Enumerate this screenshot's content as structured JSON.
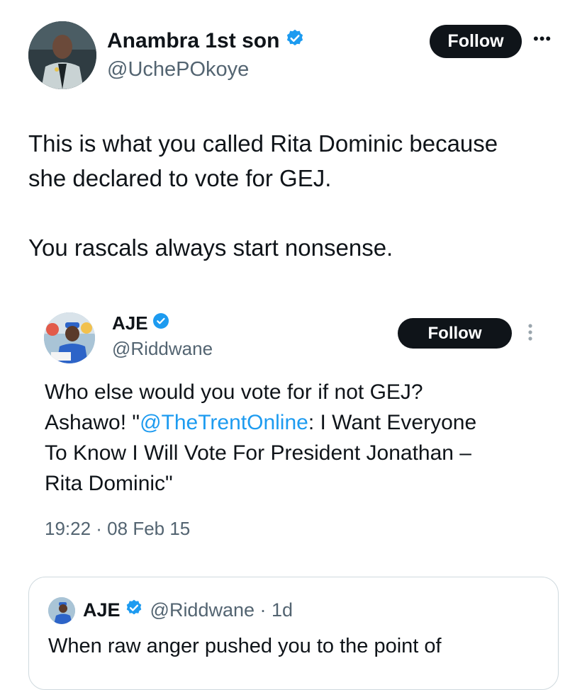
{
  "main_tweet": {
    "author_name": "Anambra 1st son",
    "handle": "@UchePOkoye",
    "follow_label": "Follow",
    "more_label": "•••",
    "text": "This is what you called Rita Dominic because\nshe declared to vote for GEJ.\n\nYou rascals always start nonsense."
  },
  "embedded_tweet": {
    "author_name": "AJE",
    "handle": "@Riddwane",
    "follow_label": "Follow",
    "text_before": "Who else would you vote for if not GEJ?",
    "text_line2_a": "Ashawo! \"",
    "mention": "@TheTrentOnline",
    "text_line2_b": ": I Want Everyone",
    "text_line3": "To Know I Will Vote For President Jonathan –",
    "text_line4": "Rita Dominic\"",
    "timestamp": "19:22 · 08 Feb 15"
  },
  "quote_card": {
    "author_name": "AJE",
    "handle_time": "@Riddwane · 1d",
    "text": "When raw anger pushed you to the point of"
  },
  "colors": {
    "verified": "#1d9bf0",
    "link": "#1d9bf0",
    "button": "#0f1419"
  }
}
